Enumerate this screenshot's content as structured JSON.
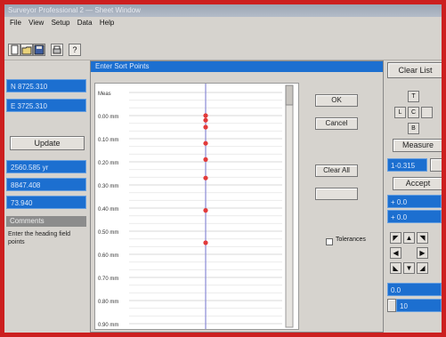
{
  "window": {
    "title": "Surveyor Professional 2 — Sheet Window"
  },
  "menu": {
    "items": [
      "File",
      "View",
      "Setup",
      "Data",
      "Help"
    ]
  },
  "toolbar": {
    "btn_help": "?"
  },
  "left_panel": {
    "field1": "N 8725.310",
    "field2": "E 3725.310",
    "update_label": "Update",
    "field3": "2560.585 yr",
    "field4": "8847.408",
    "field5": "73.940",
    "section_header": "Comments",
    "hint_text": "Enter the heading field points"
  },
  "dialog": {
    "title": "Enter Sort Points",
    "ok_label": "OK",
    "cancel_label": "Cancel",
    "clear_all_label": "Clear All",
    "tolerances_label": "Tolerances"
  },
  "chart_data": {
    "type": "scatter",
    "title": "",
    "ylabel": "Meas",
    "y_tick_labels": [
      "Meas",
      "0.00 mm",
      "0.10 mm",
      "0.20 mm",
      "0.30 mm",
      "0.40 mm",
      "0.50 mm",
      "0.60 mm",
      "0.70 mm",
      "0.80 mm",
      "0.90 mm"
    ],
    "x": [
      0,
      0,
      0,
      0,
      0,
      0,
      0,
      0
    ],
    "y": [
      0.0,
      0.02,
      0.05,
      0.12,
      0.19,
      0.27,
      0.41,
      0.55
    ],
    "point_color": "#e23b3b",
    "line_color": "#8a8ad6",
    "grid": true
  },
  "right_panel": {
    "clear_label": "Clear List",
    "pad_top": "T",
    "pad_left": "L",
    "pad_center": "C",
    "pad_bottom": "B",
    "measure_label": "Measure",
    "field1": "1-0.315",
    "accept_label": "Accept",
    "field2": "+ 0.0",
    "field3": "+ 0.0",
    "field4": "0.0",
    "field5": "10"
  }
}
